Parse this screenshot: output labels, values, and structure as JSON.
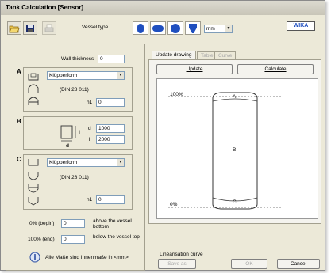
{
  "window": {
    "title": "Tank Calculation  [Sensor]"
  },
  "toolbar": {
    "vessel_type_label": "Vessel type",
    "unit_value": "mm",
    "brand": "WIKA"
  },
  "wall": {
    "label": "Wall thickness",
    "value": "0"
  },
  "section_a": {
    "letter": "A",
    "shape_value": "Klöpperform",
    "din": "(DIN 28 011)",
    "h1_label": "h1",
    "h1_value": "0"
  },
  "section_b": {
    "letter": "B",
    "d_label": "d",
    "d_value": "1000",
    "l_label": "l",
    "l_value": "2000",
    "dim_d": "d",
    "dim_l": "l"
  },
  "section_c": {
    "letter": "C",
    "shape_value": "Klöpperform",
    "din": "(DIN 28 011)",
    "h1_label": "h1",
    "h1_value": "0"
  },
  "range": {
    "begin_label": "0% (begin)",
    "begin_value": "0",
    "begin_note": "above the vessel bottom",
    "end_label": "100% (end)",
    "end_value": "0",
    "end_note": "below the vessel top"
  },
  "info_text": "Alle Maße sind Innenmaße in <mm>",
  "tabs": {
    "update_drawing": "Update drawing",
    "table": "Table",
    "curve": "Curve"
  },
  "buttons": {
    "update": "Update",
    "calculate": "Calculate",
    "save_as": "Save as",
    "ok": "OK",
    "cancel": "Cancel"
  },
  "drawing": {
    "top_percent": "100%",
    "bottom_percent": "0%",
    "label_a": "A",
    "label_b": "B",
    "label_c": "C"
  },
  "linearisation_label": "Linearisation curve",
  "colors": {
    "dialog_bg": "#ece9d8",
    "vessel_icon_blue": "#1f4fbf"
  }
}
